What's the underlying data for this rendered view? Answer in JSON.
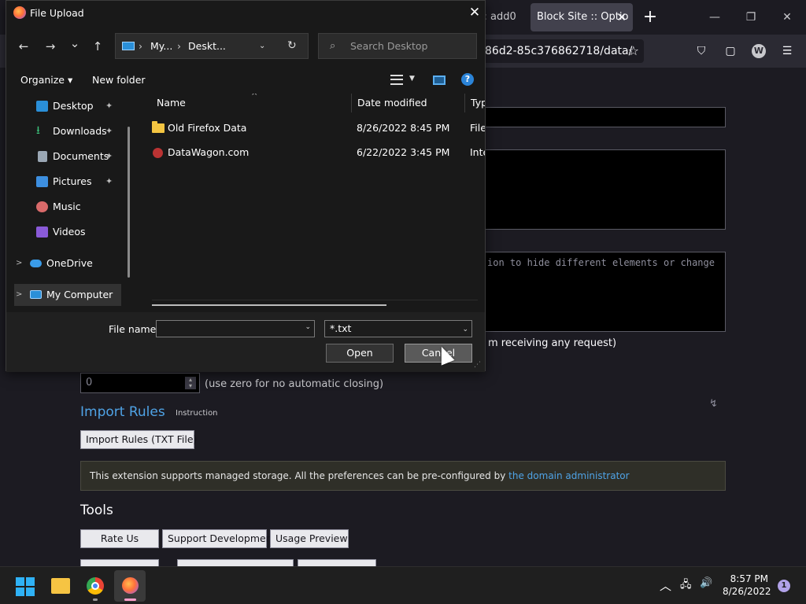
{
  "browser": {
    "tabs": [
      {
        "label": "e :: add0"
      },
      {
        "label": "Block Site :: Optio"
      }
    ],
    "tab_close_glyph": "✕",
    "new_tab_glyph": "+",
    "window_controls": {
      "minimize": "—",
      "maximize": "❐",
      "close": "✕"
    },
    "url_text": "86d2-85c376862718/data/",
    "icons": [
      "star-icon",
      "pocket-icon",
      "extension-icon",
      "profile-avatar",
      "hamburger-menu-icon"
    ],
    "profile_initial": "W"
  },
  "page": {
    "css_placeholder": "ion to hide different elements or change",
    "receive_text": "m receiving any request)",
    "close_input_value": "0",
    "close_hint": "(use zero for no automatic closing)",
    "import_title": "Import Rules",
    "import_instruction": "Instruction",
    "import_button": "Import Rules (TXT File)",
    "managed_text": "This extension supports managed storage. All the preferences can be pre-configured by ",
    "managed_link": "the domain administrator",
    "tools_title": "Tools",
    "tool_buttons": [
      "Rate Us",
      "Support Development",
      "Usage Preview"
    ]
  },
  "dialog": {
    "title": "File Upload",
    "close_glyph": "✕",
    "nav": {
      "back": "←",
      "forward": "→",
      "recent": "⌄",
      "up": "↑"
    },
    "breadcrumb": [
      "My...",
      "Deskt..."
    ],
    "breadcrumb_sep": "›",
    "search_placeholder": "Search Desktop",
    "organize": "Organize ▾",
    "new_folder": "New folder",
    "help_glyph": "?",
    "nav_items": [
      {
        "label": "Desktop",
        "pinned": true
      },
      {
        "label": "Downloads",
        "pinned": true
      },
      {
        "label": "Documents",
        "pinned": true
      },
      {
        "label": "Pictures",
        "pinned": true
      },
      {
        "label": "Music"
      },
      {
        "label": "Videos"
      },
      {
        "label": "OneDrive"
      },
      {
        "label": "My Computer"
      }
    ],
    "pin_glyph": "📌",
    "expander_glyph": ">",
    "columns": {
      "name": "Name",
      "date": "Date modified",
      "type": "Type"
    },
    "files": [
      {
        "name": "Old Firefox Data",
        "date": "8/26/2022 8:45 PM",
        "type": "File fo"
      },
      {
        "name": "DataWagon.com",
        "date": "6/22/2022 3:45 PM",
        "type": "Interne"
      }
    ],
    "filename_label": "File name:",
    "filename_value": "",
    "filter_value": "*.txt",
    "open_button": "Open",
    "cancel_button": "Cancel",
    "dropdown_glyph": "⌄"
  },
  "taskbar": {
    "time": "8:57 PM",
    "date": "8/26/2022",
    "notification_count": "1",
    "tray_icons": {
      "chevron": "︿",
      "network": "🖧",
      "volume": "🔊"
    }
  },
  "colors": {
    "accent": "#4fa3e6",
    "dialog_bg": "#191919",
    "page_bg": "#1c1b22"
  }
}
